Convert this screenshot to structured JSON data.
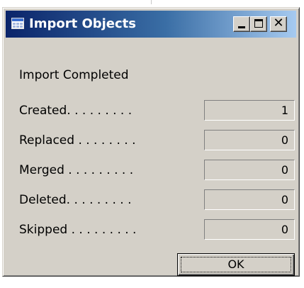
{
  "window": {
    "title": "Import Objects",
    "icon": "table-icon",
    "controls": {
      "minimize_icon": "minimize-icon",
      "maximize_icon": "maximize-icon",
      "close_glyph": "✕"
    }
  },
  "dialog": {
    "status": "Import Completed",
    "rows": [
      {
        "label": "Created. . . . . . . . .",
        "value": "1"
      },
      {
        "label": "Replaced . . . . . . . .",
        "value": "0"
      },
      {
        "label": "Merged . . . . . . . . .",
        "value": "0"
      },
      {
        "label": "Deleted. . . . . . . . .",
        "value": "0"
      },
      {
        "label": "Skipped . . . . . . . . .",
        "value": "0"
      }
    ],
    "ok_label": "OK"
  },
  "colors": {
    "titlebar_start": "#0a246a",
    "titlebar_end": "#a6caf0",
    "face": "#d4d0c8"
  }
}
